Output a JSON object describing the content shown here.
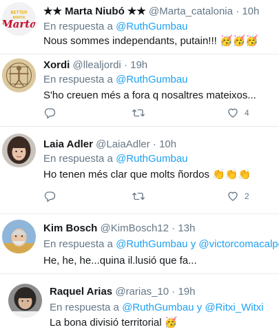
{
  "reply_prefix": "En respuesta a",
  "reply_joiner": "y",
  "tweets": [
    {
      "stars_left": "★★",
      "name": "Marta Niubó",
      "stars_right": "★★",
      "handle": "@Marta_catalonia",
      "dot": "·",
      "time": "10h",
      "reply_to": [
        "@RuthGumbau"
      ],
      "text": "Nous sommes independants, putain!!!",
      "emoji": "🥳🥳🥳",
      "avatar_text": "BETTER MARTA Marta",
      "avatar_icon": "avatar-logo"
    },
    {
      "name": "Xordi",
      "handle": "@llealjordi",
      "dot": "·",
      "time": "19h",
      "reply_to": [
        "@RuthGumbau"
      ],
      "text": "S'ho creuen més a fora q nosaltres mateixos...",
      "likes": "4",
      "avatar_icon": "vitruvian-man"
    },
    {
      "name": "Laia Adler",
      "handle": "@LaiaAdler",
      "dot": "·",
      "time": "10h",
      "reply_to": [
        "@RuthGumbau"
      ],
      "text": "Ho tenen més clar que molts ñordos",
      "emoji": "👏👏👏",
      "likes": "2",
      "avatar_icon": "portrait"
    },
    {
      "name": "Kim Bosch",
      "handle": "@KimBosch12",
      "dot": "·",
      "time": "13h",
      "reply_to": [
        "@RuthGumbau",
        "@victorcomacalpe"
      ],
      "text": "He, he, he...quina il.lusió que fa...",
      "avatar_icon": "portrait"
    },
    {
      "name": "Raquel Arias",
      "handle": "@rarias_10",
      "dot": "·",
      "time": "19h",
      "reply_to": [
        "@RuthGumbau",
        "@Ritxi_Witxi"
      ],
      "text": "La bona divisió territorial",
      "emoji": "🥳",
      "avatar_icon": "portrait"
    }
  ],
  "colors": {
    "link": "#1da1f2",
    "secondary": "#657786",
    "text": "#14171a",
    "divider": "#e6ecf0"
  }
}
